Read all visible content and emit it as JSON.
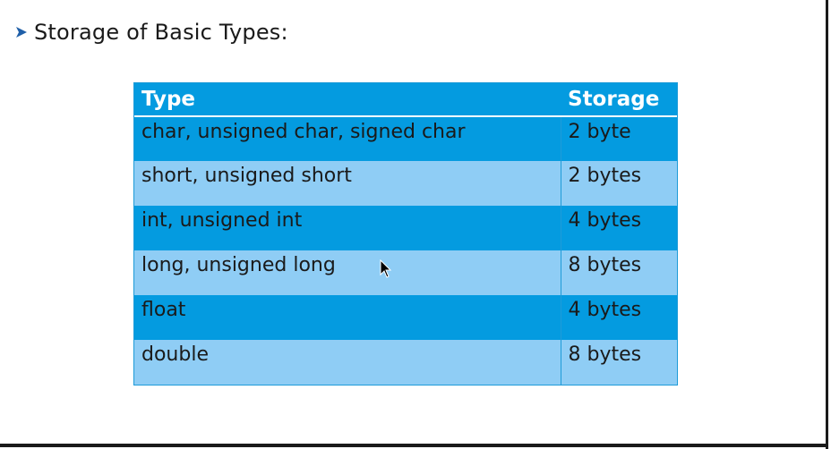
{
  "heading": {
    "bullet_icon": "arrow-bullet-icon",
    "text": "Storage of Basic Types:"
  },
  "table": {
    "headers": [
      "Type",
      "Storage"
    ],
    "rows": [
      {
        "type": "char, unsigned char, signed char",
        "storage": "2 byte"
      },
      {
        "type": "short, unsigned short",
        "storage": "2 bytes"
      },
      {
        "type": "int, unsigned int",
        "storage": "4 bytes"
      },
      {
        "type": "long, unsigned long",
        "storage": "8 bytes"
      },
      {
        "type": "float",
        "storage": "4 bytes"
      },
      {
        "type": "double",
        "storage": "8 bytes"
      }
    ]
  },
  "colors": {
    "header_bg": "#049be0",
    "row_dark": "#049be0",
    "row_light": "#8fcdf5",
    "bullet": "#1f5fa8"
  },
  "cursor_icon": "mouse-pointer-icon"
}
